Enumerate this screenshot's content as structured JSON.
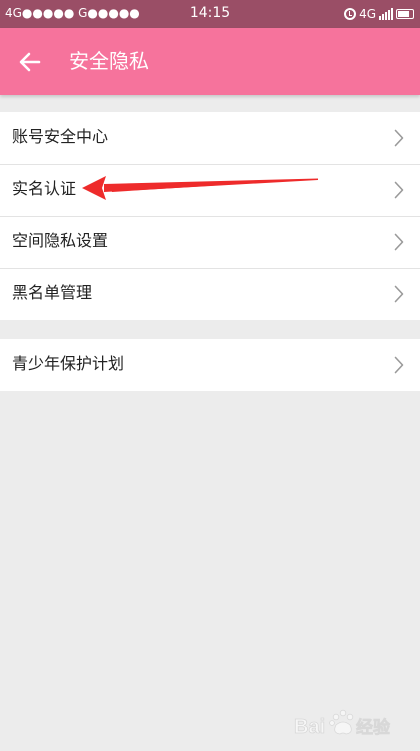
{
  "status_bar": {
    "left_text": "4G●●●●● G●●●●●",
    "time": "14:15",
    "network": "4G",
    "icons": [
      "alarm-icon",
      "signal-icon",
      "battery-icon"
    ]
  },
  "header": {
    "back_icon": "arrow-left-icon",
    "title": "安全隐私",
    "color": "#f6739c"
  },
  "groups": [
    {
      "items": [
        {
          "label": "账号安全中心",
          "icon": "chevron-right-icon"
        },
        {
          "label": "实名认证",
          "icon": "chevron-right-icon"
        },
        {
          "label": "空间隐私设置",
          "icon": "chevron-right-icon"
        },
        {
          "label": "黑名单管理",
          "icon": "chevron-right-icon"
        }
      ]
    },
    {
      "items": [
        {
          "label": "青少年保护计划",
          "icon": "chevron-right-icon"
        }
      ]
    }
  ],
  "annotation": {
    "type": "arrow",
    "color": "#ee2b2b",
    "points_to": "实名认证"
  },
  "watermark": {
    "text": "Bai du 经验"
  }
}
